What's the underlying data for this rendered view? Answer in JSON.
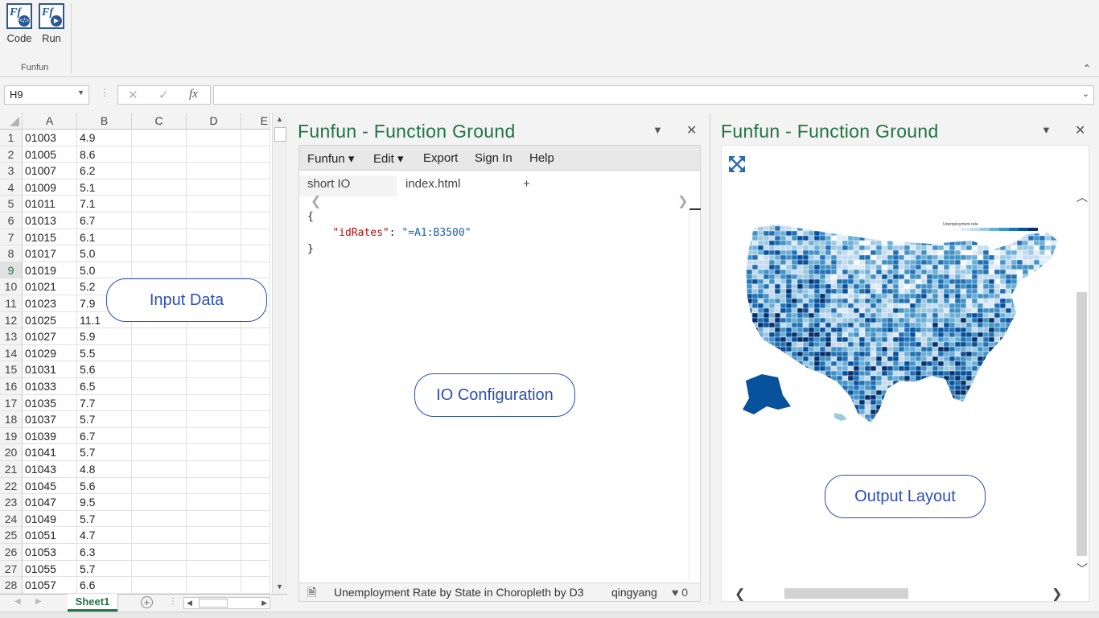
{
  "ribbon": {
    "buttons": [
      {
        "label": "Code",
        "icon": "funfun-code-icon"
      },
      {
        "label": "Run",
        "icon": "funfun-run-icon"
      }
    ],
    "group_label": "Funfun"
  },
  "formula_bar": {
    "name_box": "H9",
    "cancel_icon": "✕",
    "enter_icon": "✓",
    "fx_label": "fx",
    "value": ""
  },
  "sheet": {
    "columns": [
      "A",
      "B",
      "C",
      "D",
      "E"
    ],
    "selected_row": 9,
    "rows": [
      {
        "n": "1",
        "a": "01003",
        "b": "4.9"
      },
      {
        "n": "2",
        "a": "01005",
        "b": "8.6"
      },
      {
        "n": "3",
        "a": "01007",
        "b": "6.2"
      },
      {
        "n": "4",
        "a": "01009",
        "b": "5.1"
      },
      {
        "n": "5",
        "a": "01011",
        "b": "7.1"
      },
      {
        "n": "6",
        "a": "01013",
        "b": "6.7"
      },
      {
        "n": "7",
        "a": "01015",
        "b": "6.1"
      },
      {
        "n": "8",
        "a": "01017",
        "b": "5.0"
      },
      {
        "n": "9",
        "a": "01019",
        "b": "5.0"
      },
      {
        "n": "10",
        "a": "01021",
        "b": "5.2"
      },
      {
        "n": "11",
        "a": "01023",
        "b": "7.9"
      },
      {
        "n": "12",
        "a": "01025",
        "b": "11.1"
      },
      {
        "n": "13",
        "a": "01027",
        "b": "5.9"
      },
      {
        "n": "14",
        "a": "01029",
        "b": "5.5"
      },
      {
        "n": "15",
        "a": "01031",
        "b": "5.6"
      },
      {
        "n": "16",
        "a": "01033",
        "b": "6.5"
      },
      {
        "n": "17",
        "a": "01035",
        "b": "7.7"
      },
      {
        "n": "18",
        "a": "01037",
        "b": "5.7"
      },
      {
        "n": "19",
        "a": "01039",
        "b": "6.7"
      },
      {
        "n": "20",
        "a": "01041",
        "b": "5.7"
      },
      {
        "n": "21",
        "a": "01043",
        "b": "4.8"
      },
      {
        "n": "22",
        "a": "01045",
        "b": "5.6"
      },
      {
        "n": "23",
        "a": "01047",
        "b": "9.5"
      },
      {
        "n": "24",
        "a": "01049",
        "b": "5.7"
      },
      {
        "n": "25",
        "a": "01051",
        "b": "4.7"
      },
      {
        "n": "26",
        "a": "01053",
        "b": "6.3"
      },
      {
        "n": "27",
        "a": "01055",
        "b": "5.7"
      },
      {
        "n": "28",
        "a": "01057",
        "b": "6.6"
      }
    ],
    "tab": "Sheet1"
  },
  "callouts": {
    "input": "Input Data",
    "io": "IO Configuration",
    "output": "Output Layout"
  },
  "editor_panel": {
    "title": "Funfun - Function Ground",
    "menu": [
      "Funfun ▾",
      "Edit ▾",
      "Export",
      "Sign In",
      "Help"
    ],
    "tabs": [
      "short IO",
      "index.html",
      "+"
    ],
    "code": {
      "open": "{",
      "key": "\"idRates\"",
      "colon": ": ",
      "value": "\"=A1:B3500\"",
      "close": "}"
    },
    "status": {
      "title": "Unemployment Rate by State in Choropleth by D3",
      "author": "qingyang",
      "likes": "♥ 0"
    }
  },
  "output_panel": {
    "title": "Funfun - Function Ground",
    "map_legend_title": "Unemployment rate",
    "colors": {
      "light": "#deebf7",
      "mid": "#6baed6",
      "dark": "#08519c",
      "darkest": "#08306b"
    }
  }
}
